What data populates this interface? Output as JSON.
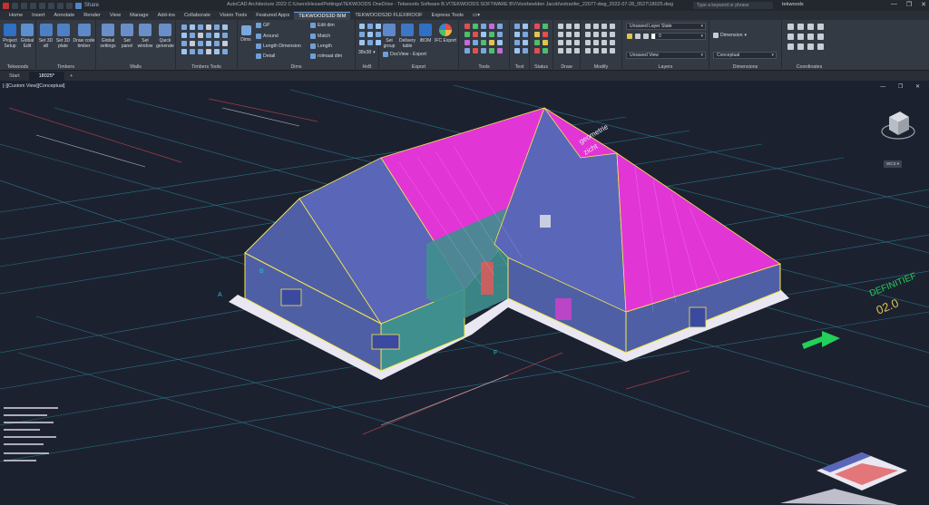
{
  "titlebar": {
    "share_label": "Share",
    "title": "AutoCAD Architecture 2022    C:\\Users\\HesselPettinga\\TEKWOODS OneDrive - Tekwoods Software B.V\\TEKWOODS SOFTWARE BV\\Voorbeelden Jacob\\extranfer_22077-dwg_2022-07-28_0527\\18025.dwg",
    "search_placeholder": "Type a keyword or phrase",
    "user": "tekwoods",
    "window_controls": [
      "—",
      "❐",
      "✕"
    ]
  },
  "ribbon_tabs": [
    {
      "label": "Home",
      "active": false
    },
    {
      "label": "Insert",
      "active": false
    },
    {
      "label": "Annotate",
      "active": false
    },
    {
      "label": "Render",
      "active": false
    },
    {
      "label": "View",
      "active": false
    },
    {
      "label": "Manage",
      "active": false
    },
    {
      "label": "Add-ins",
      "active": false
    },
    {
      "label": "Collaborate",
      "active": false
    },
    {
      "label": "Vision Tools",
      "active": false
    },
    {
      "label": "Featured Apps",
      "active": false
    },
    {
      "label": "TEKWOODS3D BIM",
      "active": true
    },
    {
      "label": "TEKWOODS3D FLEXIROOF",
      "active": false
    },
    {
      "label": "Express Tools",
      "active": false
    }
  ],
  "ribbon": {
    "panels": {
      "tekwoods": "Tekwoods",
      "timbers": "Timbers",
      "walls": "Walls",
      "timbers_tools": "Timbers Tools",
      "dims": "Dims",
      "hxb": "HxB",
      "export": "Export",
      "tools": "Tools",
      "text": "Text",
      "status": "Status",
      "draw": "Draw",
      "modify": "Modify",
      "layers": "Layers",
      "dimensions": "Dimensions",
      "coordinates": "Coordinates"
    },
    "buttons": {
      "project_setup": "Project Setup",
      "global_edit": "Global Edit",
      "set_3d_sill": "Set 3D sill",
      "set_3d_plate": "Set 3D plate",
      "draw_code_timber": "Draw code timber",
      "global_settings": "Global settings",
      "set_panel": "Set panel",
      "set_window": "Set window",
      "quick_generate": "Quick generate",
      "dims": "Dims",
      "gp": "GP",
      "around": "Around",
      "length_dimension": "Length Dimension",
      "detail": "Detail",
      "edit_dim": "Edit dim",
      "match": "Match",
      "length": "Length",
      "rolmaat_dim": "rolmaat dim",
      "hxb_value": "38x38",
      "set_group": "Set group",
      "delivery_table": "Delivery table",
      "ibom": "iBOM",
      "ifc_export": "IFC Export",
      "docview_export": "DocView - Export"
    },
    "layers": {
      "layer_state": "Unsaved Layer State",
      "current_layer": "0",
      "view": "Unsaved View"
    },
    "dimensions": {
      "dimension_label": "Dimension",
      "visual_style": "Conceptual"
    }
  },
  "doc_tabs": [
    {
      "label": "Start",
      "active": false
    },
    {
      "label": "18025*",
      "active": true
    }
  ],
  "viewport": {
    "label": "[-][Custom View][Conceptual]",
    "controls": "— ❐ ✕",
    "annotations": {
      "geometry_text": "geometrie",
      "sight_text": "zicht",
      "definitive": "DEFINITIEF",
      "definitive_number": "02.0",
      "grid_a": "A",
      "grid_b": "B",
      "grid_f": "F"
    }
  },
  "colors": {
    "background": "#1c2130",
    "ribbon": "#333a44",
    "roof_magenta": "#e235d6",
    "roof_blue": "#5a66b8",
    "wall_blue": "#4f5fa6",
    "outline_yellow": "#f5e84a",
    "base": "#e9e7f2",
    "grid_cyan": "#2fb8c9",
    "accent_green": "#23d05a"
  }
}
